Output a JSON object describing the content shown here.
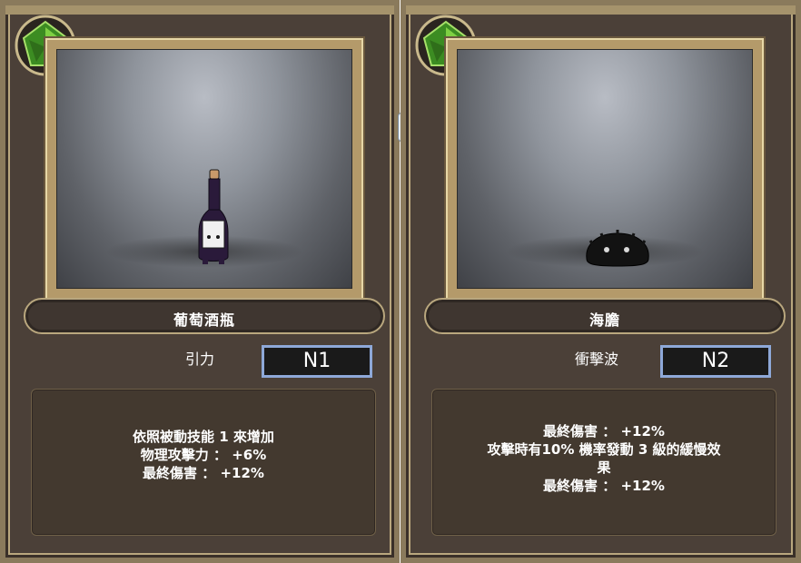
{
  "cards": [
    {
      "item_name": "葡萄酒瓶",
      "skill": "引力",
      "tag": "N1",
      "description": [
        "依照被動技能 1 來增加",
        "物理攻擊力 ： +6%",
        "最終傷害 ： +12%"
      ],
      "gem_icon": "green-gem-icon",
      "sprite_icon": "wine-bottle-icon"
    },
    {
      "item_name": "海膽",
      "skill": "衝擊波",
      "tag": "N2",
      "description": [
        "最終傷害 ： +12%",
        "攻擊時有10% 機率發動 3 級的緩慢效",
        "果",
        "最終傷害 ： +12%"
      ],
      "gem_icon": "green-gem-icon",
      "sprite_icon": "sea-urchin-icon"
    }
  ],
  "colors": {
    "card_bg": "#4b4038",
    "frame_gold": "#b49a6a",
    "tag_border": "#8ea8d8",
    "gem_green": "#4caf2a"
  }
}
